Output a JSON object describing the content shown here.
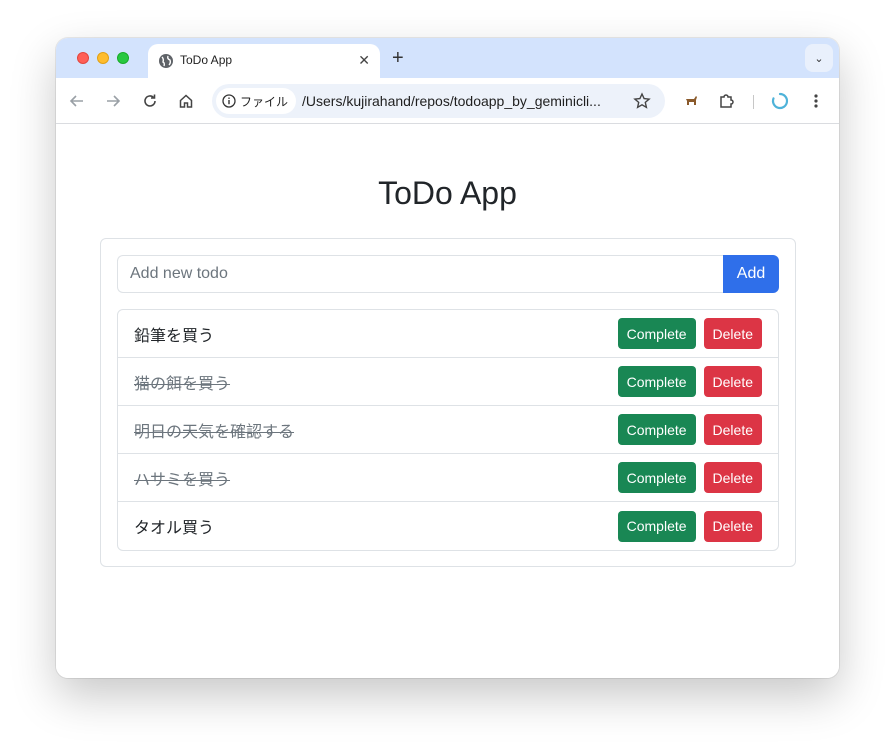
{
  "browser": {
    "tab_title": "ToDo App",
    "tab_close": "✕",
    "new_tab": "+",
    "tab_menu": "⌄",
    "site_chip_label": "ファイル",
    "url": "/Users/kujirahand/repos/todoapp_by_geminicli..."
  },
  "app": {
    "title": "ToDo App",
    "input_placeholder": "Add new todo",
    "add_label": "Add",
    "todos": [
      {
        "text": "鉛筆を買う",
        "completed": false,
        "complete_label": "Complete",
        "delete_label": "Delete"
      },
      {
        "text": "猫の餌を買う",
        "completed": true,
        "complete_label": "Complete",
        "delete_label": "Delete"
      },
      {
        "text": "明日の天気を確認する",
        "completed": true,
        "complete_label": "Complete",
        "delete_label": "Delete"
      },
      {
        "text": "ハサミを買う",
        "completed": true,
        "complete_label": "Complete",
        "delete_label": "Delete"
      },
      {
        "text": "タオル買う",
        "completed": false,
        "complete_label": "Complete",
        "delete_label": "Delete"
      }
    ]
  },
  "colors": {
    "primary": "#2f6fea",
    "success": "#198754",
    "danger": "#dc3545",
    "tabbar": "#d3e3fd"
  }
}
